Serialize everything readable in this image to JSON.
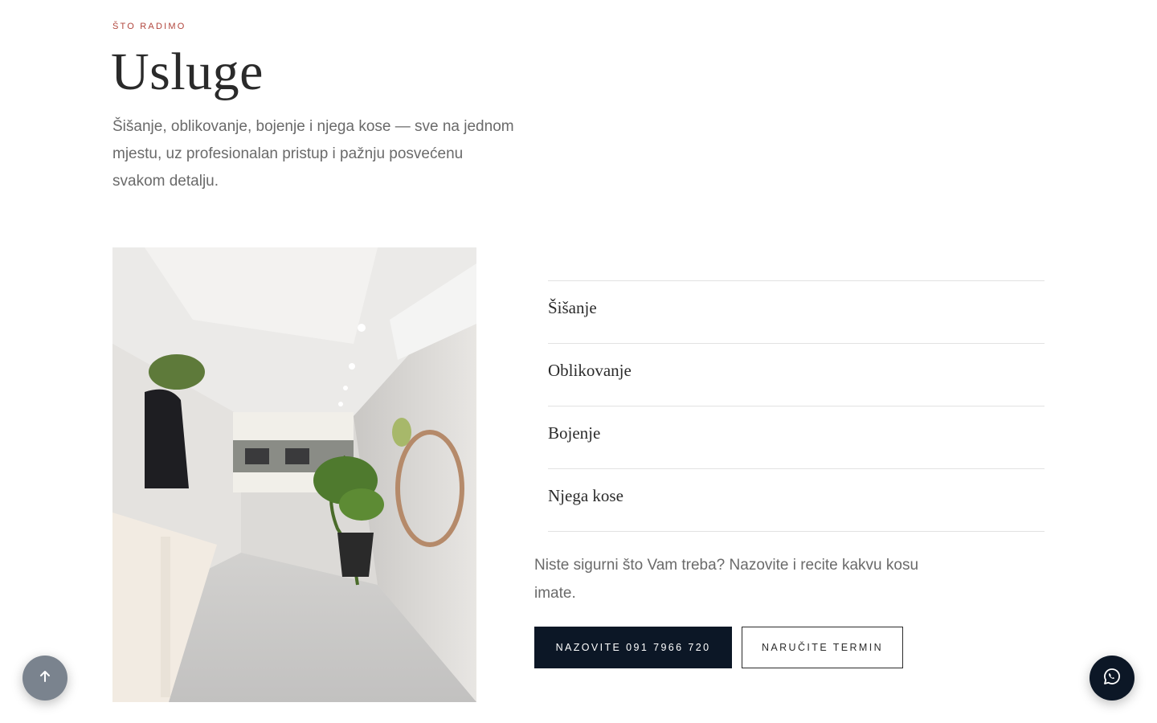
{
  "section": {
    "eyebrow": "ŠTO RADIMO",
    "title": "Usluge",
    "intro": "Šišanje, oblikovanje, bojenje i njega kose — sve na jednom mjestu, uz profesionalan pristup i pažnju posvećenu svakom detalju."
  },
  "services": [
    {
      "label": "Šišanje"
    },
    {
      "label": "Oblikovanje"
    },
    {
      "label": "Bojenje"
    },
    {
      "label": "Njega kose"
    }
  ],
  "cta": {
    "hint": "Niste sigurni što Vam treba? Nazovite i recite kakvu kosu imate.",
    "call_label": "NAZOVITE 091 7966 720",
    "book_label": "NARUČITE TERMIN"
  },
  "floating": {
    "scroll_top_icon": "arrow-up-icon",
    "whatsapp_icon": "whatsapp-icon"
  },
  "colors": {
    "accent": "#b1453c",
    "primary_button": "#0c1726",
    "scroll_button": "#7a838e"
  }
}
